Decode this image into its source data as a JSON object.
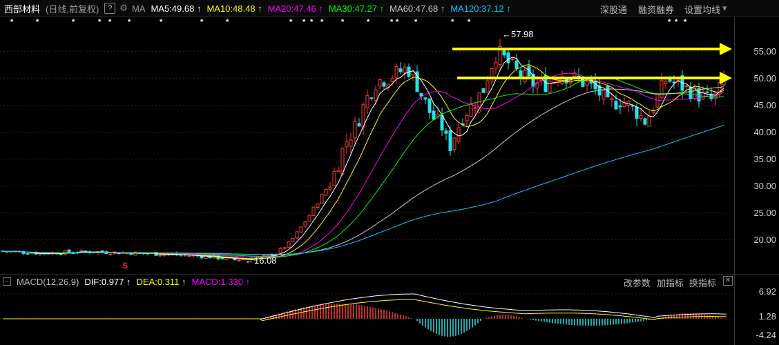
{
  "header": {
    "stock_name": "西部材料",
    "period": "(日线,前复权)",
    "help_btn": "?",
    "ma_label": "MA",
    "ma_items": [
      {
        "text": "MA5:49.68 ↑",
        "color": "#ffffff"
      },
      {
        "text": "MA10:48.48 ↑",
        "color": "#ffff00"
      },
      {
        "text": "MA20:47.46 ↑",
        "color": "#ff00ff"
      },
      {
        "text": "MA30:47.27 ↑",
        "color": "#00ff00"
      },
      {
        "text": "MA60:47.68 ↑",
        "color": "#cccccc"
      },
      {
        "text": "MA120:37.12 ↑",
        "color": "#00ccff"
      }
    ],
    "btn_shengutong": "深股通",
    "btn_rongzi": "融资融券",
    "btn_settings": "设置均线",
    "settings_arrow": "▾"
  },
  "price_axis": [
    "55.00",
    "50.00",
    "45.00",
    "40.00",
    "35.00",
    "30.00",
    "25.00",
    "20.00"
  ],
  "annotations": {
    "high_label": "←57.98",
    "low_label": "←16.08",
    "s_marker": "S"
  },
  "macd": {
    "toggle": "−",
    "label": "MACD(12,26,9)",
    "dif": {
      "text": "DIF:0.977 ↑",
      "color": "#ffffff"
    },
    "dea": {
      "text": "DEA:0.311 ↑",
      "color": "#ffff00"
    },
    "macd": {
      "text": "MACD:1.330 ↑",
      "color": "#ff00ff"
    },
    "btn_params": "改参数",
    "btn_add": "加指标",
    "btn_switch": "换指标",
    "close": "✕",
    "axis": [
      "6.92",
      "1.28",
      "-4.24"
    ]
  },
  "colors": {
    "up": "#ff3c3c",
    "down": "#28e0e8",
    "ma5": "#ffffff",
    "ma10": "#ffff00",
    "ma20": "#ff00ff",
    "ma30": "#00ff00",
    "ma60": "#cccccc",
    "ma120": "#00ccff",
    "arrow": "#ffff00"
  },
  "star_marker": "*"
}
